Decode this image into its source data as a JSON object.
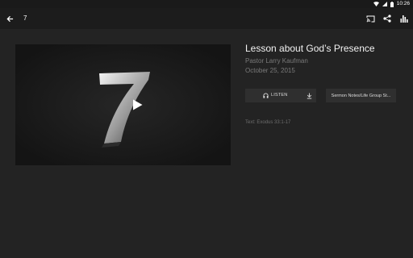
{
  "status_bar": {
    "time": "10:26",
    "icons": [
      "wifi-icon",
      "signal-icon",
      "battery-icon"
    ]
  },
  "app_bar": {
    "title": "7",
    "back_icon": "arrow-back-icon",
    "actions": [
      "cast-icon",
      "share-icon",
      "bar-chart-icon"
    ]
  },
  "video": {
    "thumbnail_text": "7",
    "play_icon": "play-icon"
  },
  "sermon": {
    "title": "Lesson about God’s Presence",
    "speaker": "Pastor Larry Kaufman",
    "date": "October 25, 2015",
    "listen_label": "LISTEN",
    "notes_label": "Sermon Notes/Life Group St...",
    "scripture": "Text: Exodus 33:1-17"
  },
  "colors": {
    "background": "#232323",
    "app_bar": "#1c1c1c",
    "button": "#2f2f2f",
    "muted_text": "#7a7a7a"
  }
}
